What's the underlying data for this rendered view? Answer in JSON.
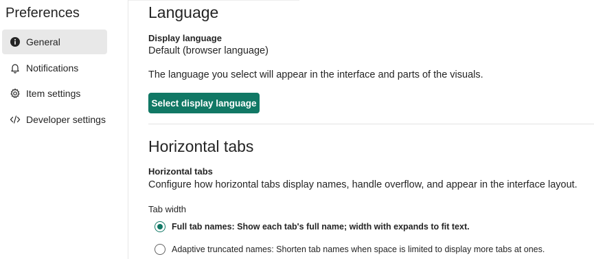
{
  "sidebar": {
    "title": "Preferences",
    "items": [
      {
        "label": "General",
        "icon": "info-icon",
        "active": true
      },
      {
        "label": "Notifications",
        "icon": "bell-icon",
        "active": false
      },
      {
        "label": "Item settings",
        "icon": "gear-icon",
        "active": false
      },
      {
        "label": "Developer settings",
        "icon": "code-icon",
        "active": false
      }
    ]
  },
  "language": {
    "title": "Language",
    "display_label": "Display language",
    "display_value": "Default (browser language)",
    "description": "The language you select will appear in the interface and parts of the visuals.",
    "button_label": "Select display language"
  },
  "horizontal_tabs": {
    "title": "Horizontal tabs",
    "label": "Horizontal tabs",
    "description": "Configure how horizontal tabs display names, handle overflow, and appear in the interface layout.",
    "tab_width_label": "Tab width",
    "options": [
      {
        "label": "Full tab names: Show each tab's full name; width with expands to fit text.",
        "checked": true
      },
      {
        "label": "Adaptive truncated names: Shorten tab names when space is limited to display more tabs at ones.",
        "checked": false
      }
    ]
  },
  "colors": {
    "accent": "#117865",
    "active_nav_bg": "#e8e8e8"
  }
}
